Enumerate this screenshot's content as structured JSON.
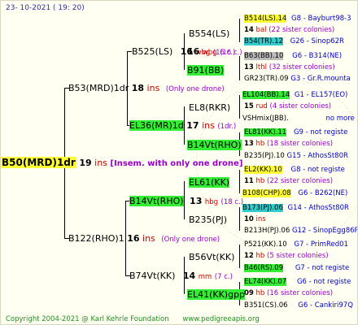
{
  "header": {
    "date": "23- 10-2021 ( 19: 20)"
  },
  "footer": {
    "copyright": "Copyright 2004-2021 @ Karl Kehrle Foundation",
    "url": "www.pedigreeapis.org"
  },
  "root": {
    "id": "B50(MRD)1dr",
    "num": "19",
    "ins": "ins",
    "note": "[Insem. with only one drone]"
  },
  "gen1": [
    {
      "id": "B53(MRD)1dr",
      "num": "18",
      "ins": "ins",
      "note": "(Only one drone)"
    },
    {
      "id": "B122(RHO)1",
      "num": "16",
      "ins": "ins",
      "note": "(Only one drone)"
    }
  ],
  "gen2": [
    {
      "id": "B525(LS)",
      "num": "16",
      "ins": "wbg",
      "note": "(16 c.)"
    },
    {
      "id": "EL36(MR)1d",
      "num": "17",
      "ins": "ins",
      "note": "(1dr.)"
    },
    {
      "id": "B14Vt(RHO)",
      "num": "13",
      "ins": "hbg",
      "note": "(18 c.)"
    },
    {
      "id": "B74Vt(KK)",
      "num": "14",
      "ins": "mm",
      "note": "(7 c.)"
    }
  ],
  "gen3": [
    {
      "id": "B554(LS)",
      "num": "16",
      "ins": "wbg",
      "note": "(16 c.)"
    },
    {
      "id": "B91(BB)"
    },
    {
      "id": "EL8(RKR)",
      "num": "15",
      "ins": "rud",
      "note": "(4 sister colonies)"
    },
    {
      "id": "B14Vt(RHO)",
      "num": "13",
      "ins": "hb",
      "note": "(18 sister colonies)"
    },
    {
      "id": "EL61(KK)",
      "num": "11",
      "ins": "hb",
      "note": "(22 sister colonies)"
    },
    {
      "id": "B235(PJ)",
      "num": "10",
      "ins": "ins"
    },
    {
      "id": "B56Vt(KK)",
      "num": "12",
      "ins": "hb",
      "note": "(5 sister colonies)"
    },
    {
      "id": "EL41(KK)gpp",
      "num": "09",
      "ins": "hb",
      "note": "(16 sister colonies)"
    }
  ],
  "gen4": [
    {
      "id": "B514(LS).14",
      "info": "G8 - Bayburt98-3"
    },
    {
      "line2": "14",
      "ins": "bal",
      "note": "(22 sister colonies)"
    },
    {
      "id": "B54(TR).12",
      "info": "G26 - Sinop62R"
    },
    {
      "id": "B63(BB).10",
      "info": "G6 - B314(NE)"
    },
    {
      "line2": "13",
      "ins": "lthl",
      "note": "(32 sister colonies)"
    },
    {
      "id": "GR23(TR).09",
      "info": "G3 - Gr.R.mounta"
    },
    {
      "id": "EL104(BB).14",
      "info": "G1 - EL157(EO)"
    },
    {
      "id": "VSHmix(JBB).",
      "info": "no more"
    },
    {
      "id": "EL81(KK).11",
      "info": "G9 - not registe"
    },
    {
      "id": "B235(PJ).10",
      "info": "G15 - AthosSt80R"
    },
    {
      "id": "EL2(KK).10",
      "info": "G8 - not registe"
    },
    {
      "id": "B108(CHP).08",
      "info": "G6 - B262(NE)"
    },
    {
      "id": "B173(PJ).06",
      "info": "G14 - AthosSt80R"
    },
    {
      "id": "B213H(PJ).06",
      "info": "G12 - SinopEgg86R"
    },
    {
      "id": "P521(KK).10",
      "info": "G7 - PrimRed01"
    },
    {
      "id": "B46(RS).09",
      "info": "G7 - not registe"
    },
    {
      "id": "EL74(KK).07",
      "info": "G6 - not registe"
    },
    {
      "id": "B351(CS).06",
      "info": "G6 - Cankiri97Q"
    }
  ]
}
